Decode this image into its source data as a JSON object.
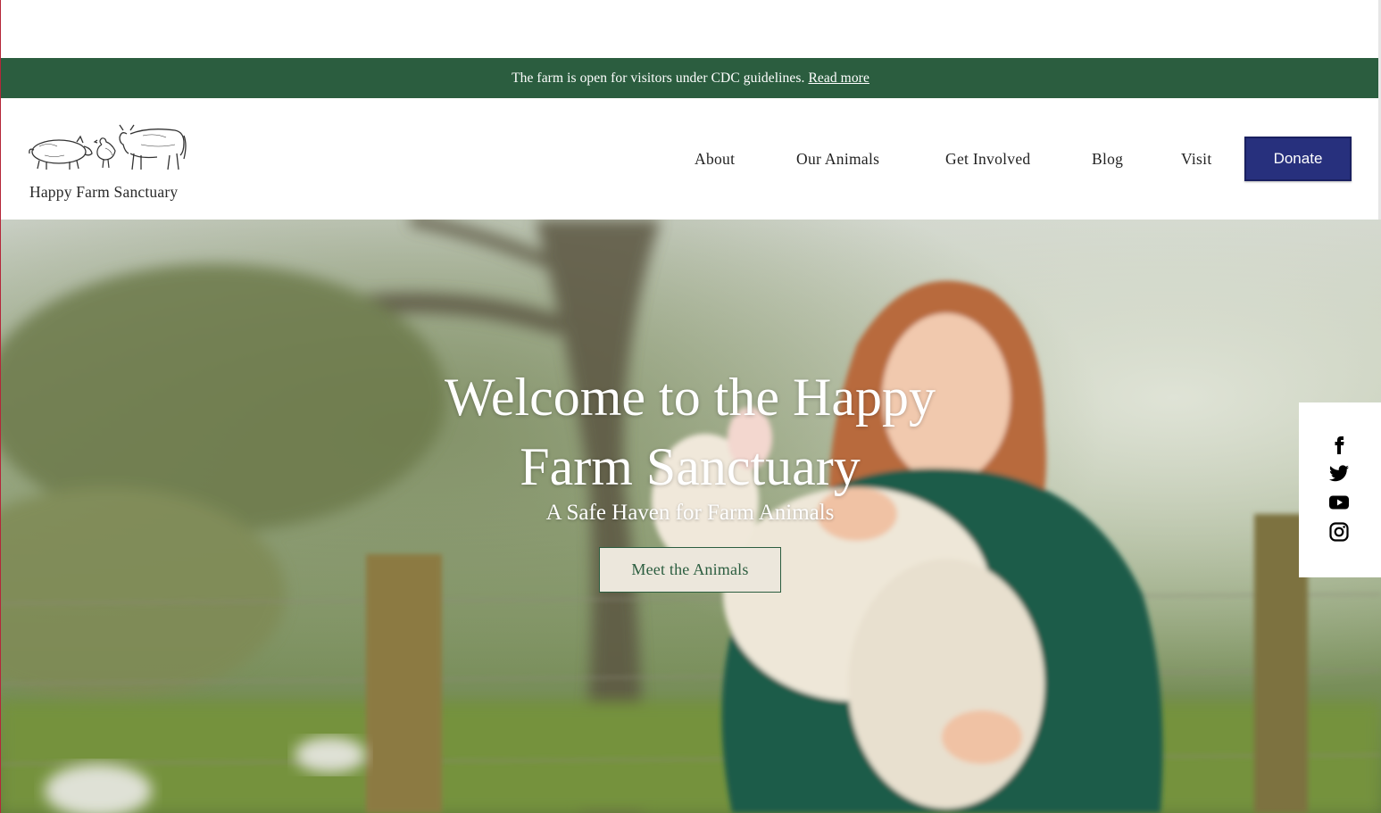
{
  "announcement": {
    "text": "The farm is open for visitors under CDC guidelines.",
    "link_label": "Read more"
  },
  "brand": {
    "name": "Happy Farm Sanctuary",
    "logo_icon": "farm-animals-sketch"
  },
  "nav": {
    "items": [
      {
        "label": "About"
      },
      {
        "label": "Our Animals"
      },
      {
        "label": "Get Involved"
      },
      {
        "label": "Blog"
      },
      {
        "label": "Visit"
      }
    ],
    "donate_label": "Donate"
  },
  "hero": {
    "title_line1": "Welcome to the Happy",
    "title_line2": "Farm Sanctuary",
    "subtitle": "A Safe Haven for Farm Animals",
    "cta_label": "Meet the Animals"
  },
  "social": {
    "icons": [
      "facebook-icon",
      "twitter-icon",
      "youtube-icon",
      "instagram-icon"
    ]
  },
  "colors": {
    "banner_green": "#2b5d3f",
    "donate_blue": "#27307d",
    "cta_bg": "#ece7dc"
  }
}
